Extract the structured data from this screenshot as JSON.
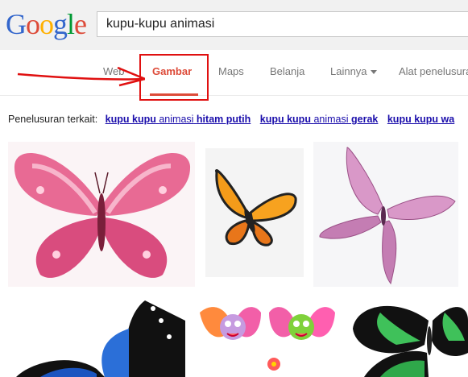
{
  "logo": {
    "letters": [
      "G",
      "o",
      "o",
      "g",
      "l",
      "e"
    ],
    "colors": [
      "#3366cc",
      "#dd4b39",
      "#ffb000",
      "#3366cc",
      "#009933",
      "#dd4b39"
    ]
  },
  "search": {
    "value": "kupu-kupu animasi"
  },
  "nav": {
    "web": "Web",
    "images": "Gambar",
    "maps": "Maps",
    "shopping": "Belanja",
    "more": "Lainnya",
    "tools": "Alat penelusuran"
  },
  "related": {
    "label": "Penelusuran terkait:",
    "items": [
      {
        "bold1": "kupu kupu",
        "lite": "animasi",
        "bold2": "hitam putih"
      },
      {
        "bold1": "kupu kupu",
        "lite": "animasi",
        "bold2": "gerak"
      },
      {
        "bold1": "kupu kupu",
        "lite": "",
        "bold2": "wa"
      }
    ]
  },
  "colors": {
    "accent": "#dd4b39",
    "link": "#1a0dab",
    "annotation": "#e01010"
  }
}
